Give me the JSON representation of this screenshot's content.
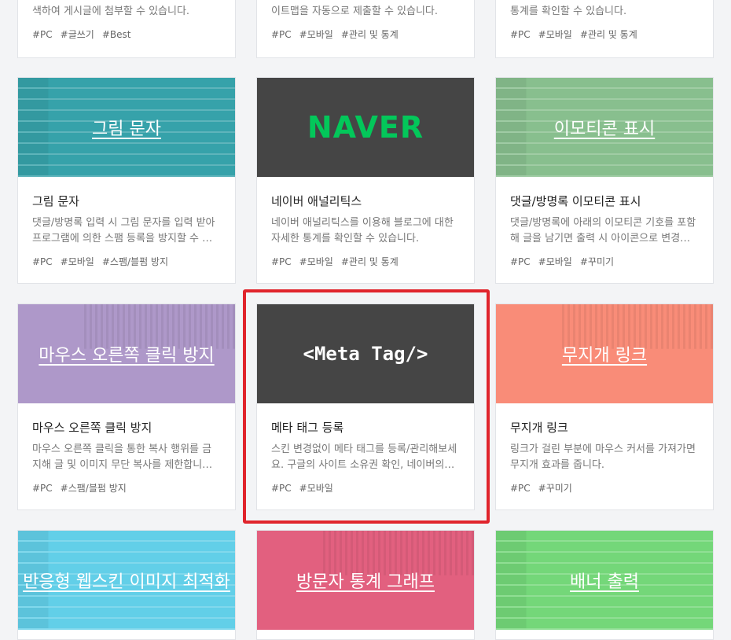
{
  "top_row": [
    {
      "desc_line": "색하여 게시글에 첨부할 수 있습니다.",
      "tags": [
        "#PC",
        "#글쓰기",
        "#Best"
      ]
    },
    {
      "desc_line": "이트맵을 자동으로 제출할 수 있습니다.",
      "tags": [
        "#PC",
        "#모바일",
        "#관리 및 통계"
      ]
    },
    {
      "desc_line": "통계를 확인할 수 있습니다.",
      "tags": [
        "#PC",
        "#모바일",
        "#관리 및 통계"
      ]
    }
  ],
  "cards": [
    {
      "thumb_label": "그림 문자",
      "thumb_color": "#36a2aa",
      "title": "그림 문자",
      "desc": "댓글/방명록 입력 시 그림 문자를 입력 받아 프로그램에 의한 스팸 등록을 방지할 수 있도록…",
      "tags": [
        "#PC",
        "#모바일",
        "#스팸/블펌 방지"
      ]
    },
    {
      "thumb_label": "NAVER",
      "thumb_color": "#454545",
      "title": "네이버 애널리틱스",
      "desc": "네이버 애널리틱스를 이용해 블로그에 대한 자세한 통계를 확인할 수 있습니다.",
      "tags": [
        "#PC",
        "#모바일",
        "#관리 및 통계"
      ]
    },
    {
      "thumb_label": "이모티콘 표시",
      "thumb_color": "#88bf8e",
      "title": "댓글/방명록 이모티콘 표시",
      "desc": "댓글/방명록에 아래의 이모티콘 기호를 포함해 글을 남기면 출력 시 아이콘으로 변경해 표시…",
      "tags": [
        "#PC",
        "#모바일",
        "#꾸미기"
      ]
    },
    {
      "thumb_label": "마우스 오른쪽 클릭 방지",
      "thumb_color": "#ae98c9",
      "title": "마우스 오른쪽 클릭 방지",
      "desc": "마우스 오른쪽 클릭을 통한 복사 행위를 금지해 글 및 이미지 무단 복사를 제한합니다. 다만 …",
      "tags": [
        "#PC",
        "#스팸/블펌 방지"
      ]
    },
    {
      "thumb_label": "<Meta Tag/>",
      "thumb_color": "#454545",
      "title": "메타 태그 등록",
      "desc": "스킨 변경없이 메타 태그를 등록/관리해보세요. 구글의 사이트 소유권 확인, 네이버의 사…",
      "tags": [
        "#PC",
        "#모바일"
      ]
    },
    {
      "thumb_label": "무지개 링크",
      "thumb_color": "#f98c78",
      "title": "무지개 링크",
      "desc": "링크가 걸린 부분에 마우스 커서를 가져가면 무지개 효과를 줍니다.",
      "tags": [
        "#PC",
        "#꾸미기"
      ]
    },
    {
      "thumb_label": "반응형 웹스킨 이미지 최적화",
      "thumb_color": "#62cfe8"
    },
    {
      "thumb_label": "방문자 통계 그래프",
      "thumb_color": "#e2607f"
    },
    {
      "thumb_label": "배너 출력",
      "thumb_color": "#74d779"
    }
  ],
  "colors": {
    "highlight": "#e0242c",
    "naver_green": "#03c75a"
  }
}
